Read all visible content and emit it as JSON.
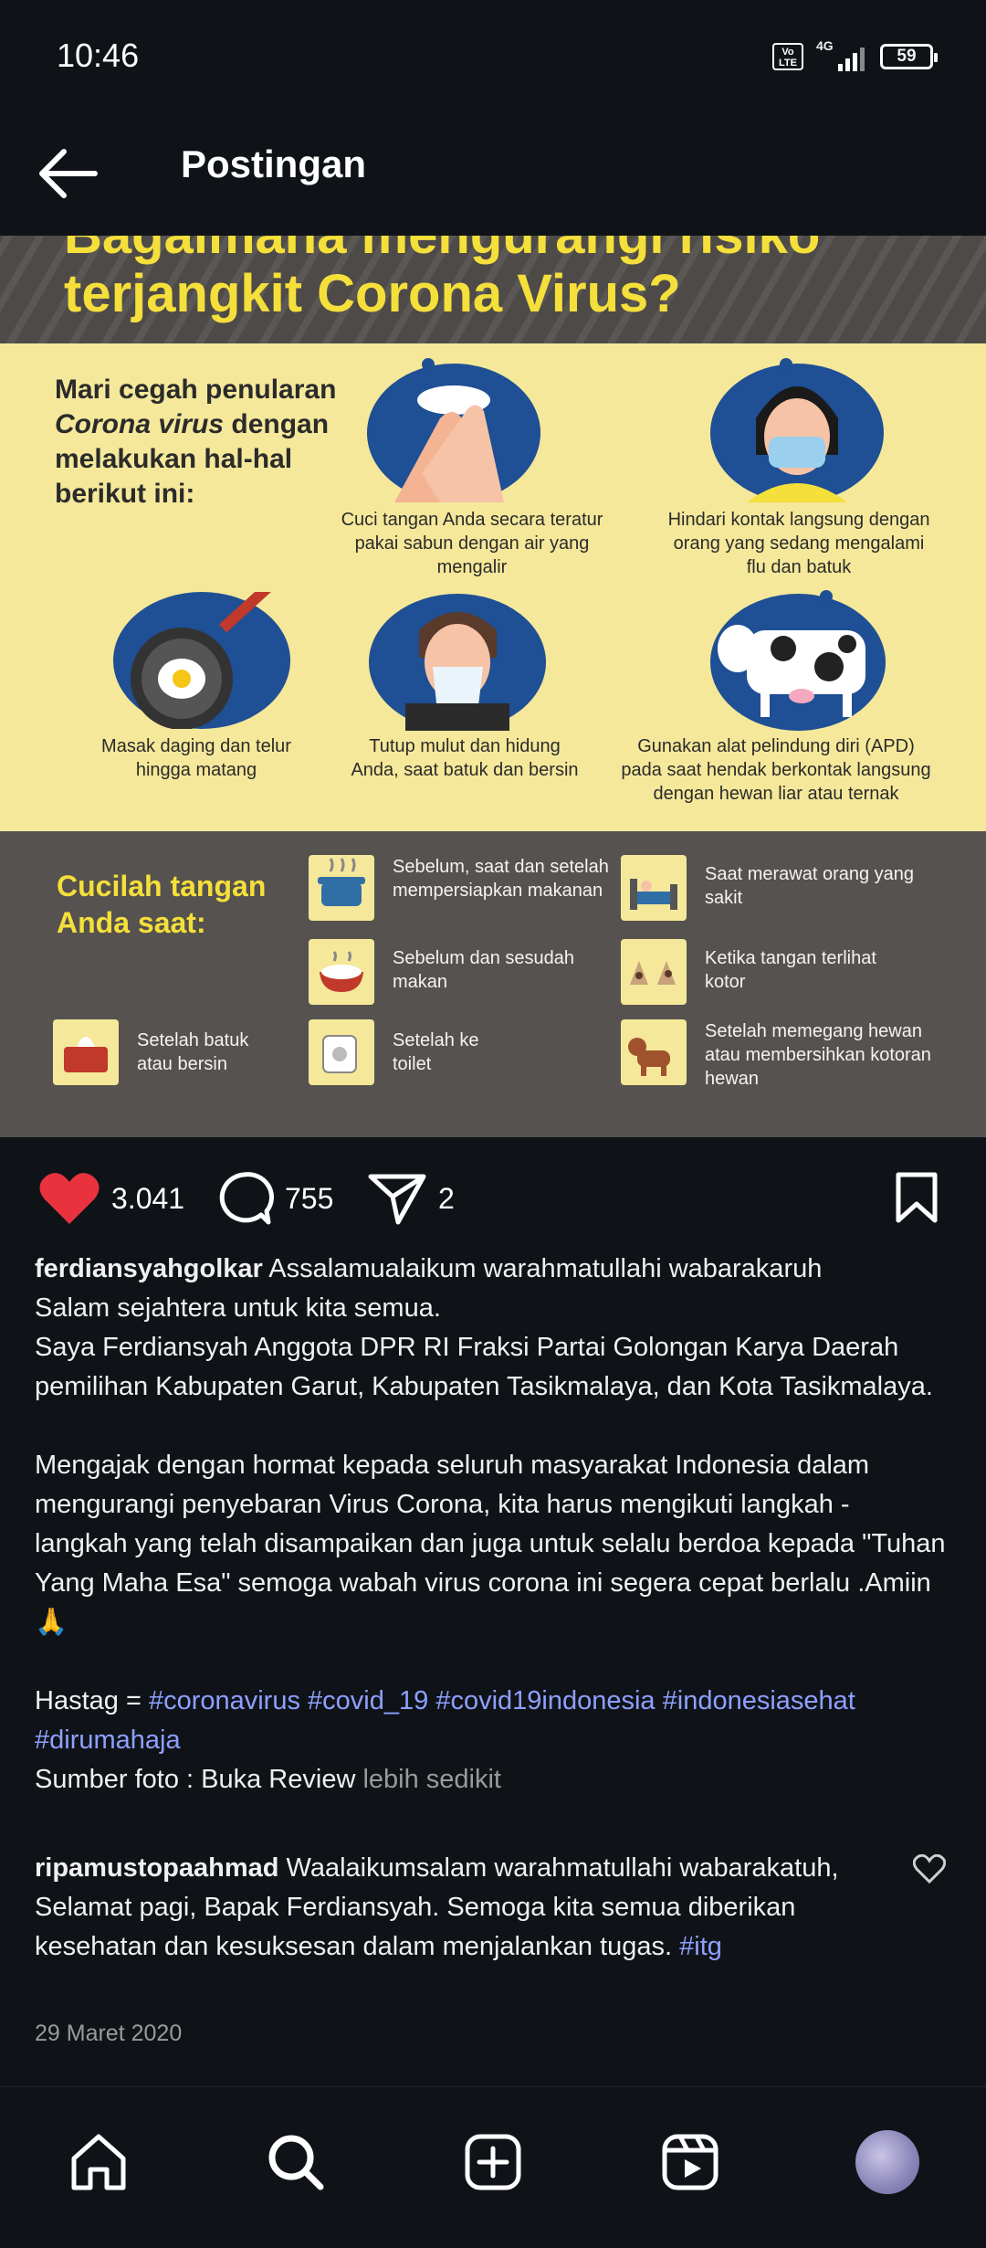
{
  "status_bar": {
    "time": "10:46",
    "volte": "Vo LTE",
    "network": "4G",
    "battery": "59"
  },
  "header": {
    "title": "Postingan",
    "back_icon": "arrow-left-icon"
  },
  "post_image": {
    "title_line1": "Bagaimana mengurangi risiko",
    "title_line2": "terjangkit Corona Virus?",
    "intro_line1": "Mari cegah penularan",
    "intro_italic": "Corona virus",
    "intro_line2_rest": " dengan",
    "intro_line3": "melakukan hal-hal",
    "intro_line4": "berikut ini:",
    "steps": [
      {
        "caption": "Cuci tangan Anda secara teratur pakai sabun dengan air yang mengalir"
      },
      {
        "caption": "Hindari kontak langsung dengan orang yang sedang mengalami flu dan batuk"
      },
      {
        "caption": "Masak daging dan telur hingga matang"
      },
      {
        "caption": "Tutup mulut dan hidung Anda, saat batuk dan bersin"
      },
      {
        "caption": "Gunakan alat pelindung diri (APD) pada saat hendak berkontak langsung dengan hewan liar atau ternak"
      }
    ],
    "wash_title_line1": "Cucilah tangan",
    "wash_title_line2": "Anda saat:",
    "wash_tips": [
      {
        "text": "Sebelum, saat dan setelah mempersiapkan makanan"
      },
      {
        "text": "Saat merawat orang yang sakit"
      },
      {
        "text": "Sebelum dan sesudah makan"
      },
      {
        "text": "Ketika tangan terlihat kotor"
      },
      {
        "text": "Setelah batuk atau bersin"
      },
      {
        "text": "Setelah ke toilet"
      },
      {
        "text": "Setelah memegang hewan atau membersihkan kotoran hewan"
      }
    ]
  },
  "actions": {
    "likes": "3.041",
    "comments": "755",
    "shares": "2",
    "like_color": "#e8333f"
  },
  "caption": {
    "username": "ferdiansyahgolkar",
    "line1": " Assalamualaikum warahmatullahi wabarakaruh",
    "line2": "Salam sejahtera untuk kita semua.",
    "line3": "Saya Ferdiansyah Anggota DPR RI Fraksi Partai Golongan Karya Daerah pemilihan Kabupaten Garut, Kabupaten Tasikmalaya, dan Kota Tasikmalaya.",
    "paragraph2": "Mengajak dengan hormat kepada seluruh masyarakat Indonesia dalam mengurangi penyebaran Virus Corona, kita harus mengikuti langkah - langkah yang telah disampaikan dan juga untuk selalu berdoa kepada \"Tuhan Yang Maha Esa\" semoga wabah virus corona ini segera cepat berlalu .Amiin🙏",
    "hashtag_prefix": "Hastag = ",
    "hashtags": [
      "#coronavirus",
      "#covid_19",
      "#covid19indonesia",
      "#indonesiasehat",
      "#dirumahaja"
    ],
    "source": "Sumber foto : Buka Review",
    "less_label": "lebih sedikit"
  },
  "comment": {
    "username": "ripamustopaahmad",
    "text": " Waalaikumsalam warahmatullahi wabarakatuh, Selamat pagi, Bapak Ferdiansyah. Semoga kita semua diberikan kesehatan dan kesuksesan dalam menjalankan tugas. ",
    "hashtag": "#itg"
  },
  "date": "29 Maret 2020",
  "bottom_nav": {
    "items": [
      "home-icon",
      "search-icon",
      "create-post-icon",
      "reels-icon",
      "profile-avatar"
    ]
  },
  "colors": {
    "background": "#0f1318",
    "hashtag": "#8ea0ff",
    "infographic_yellow": "#f5e89a",
    "infographic_blue": "#1f4f94",
    "infographic_title": "#f5df3a"
  }
}
